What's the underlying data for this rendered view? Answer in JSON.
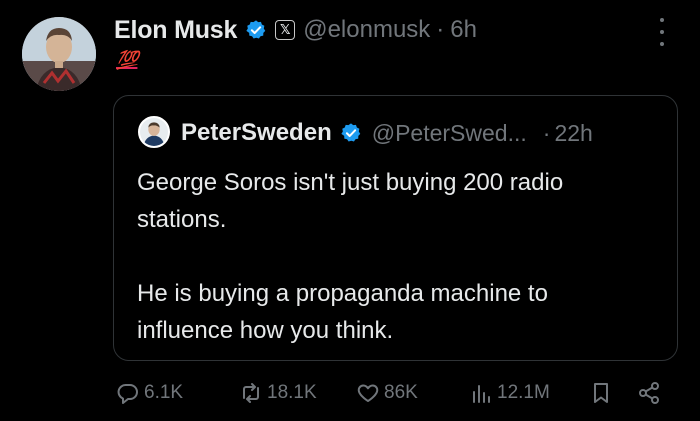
{
  "tweet": {
    "author_name": "Elon Musk",
    "author_handle": "@elonmusk",
    "separator": "·",
    "time": "6h",
    "affiliation_badge": "𝕏",
    "text": "💯",
    "avatar_icon": "user-avatar"
  },
  "quoted": {
    "author_name": "PeterSweden",
    "author_handle": "@PeterSwed...",
    "separator": "·",
    "time": "22h",
    "lines": [
      "George Soros isn't just buying 200 radio",
      "stations.",
      "He is buying a propaganda machine to",
      "influence how you think."
    ]
  },
  "actions": {
    "replies": "6.1K",
    "reposts": "18.1K",
    "likes": "86K",
    "views": "12.1M"
  },
  "colors": {
    "background": "#000000",
    "text": "#e7e9ea",
    "muted": "#71767b",
    "verified": "#1d9bf0",
    "border": "#2f3336",
    "emoji": "#e0245e"
  }
}
